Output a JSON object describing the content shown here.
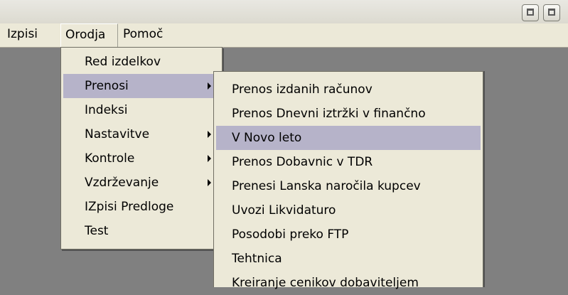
{
  "menubar": {
    "items": [
      "Izpisi",
      "Orodja",
      "Pomoč"
    ]
  },
  "orodja_menu": {
    "items": [
      {
        "label": "Red izdelkov",
        "has_submenu": false
      },
      {
        "label": "Prenosi",
        "has_submenu": true,
        "highlighted": true
      },
      {
        "label": "Indeksi",
        "has_submenu": false
      },
      {
        "label": "Nastavitve",
        "has_submenu": true
      },
      {
        "label": "Kontrole",
        "has_submenu": true
      },
      {
        "label": "Vzdrževanje",
        "has_submenu": true
      },
      {
        "label": "IZpisi Predloge",
        "has_submenu": false
      },
      {
        "label": "Test",
        "has_submenu": false
      }
    ]
  },
  "prenosi_submenu": {
    "items": [
      {
        "label": "Prenos izdanih računov"
      },
      {
        "label": "Prenos Dnevni iztržki v finančno"
      },
      {
        "label": "V Novo leto",
        "highlighted": true
      },
      {
        "label": "Prenos Dobavnic v TDR"
      },
      {
        "label": "Prenesi Lanska naročila kupcev"
      },
      {
        "label": "Uvozi Likvidaturo"
      },
      {
        "label": "Posodobi preko FTP"
      },
      {
        "label": "Tehtnica"
      },
      {
        "label": "Kreiranje cenikov dobaviteljem"
      }
    ]
  },
  "colors": {
    "menu_bg": "#ece9d8",
    "highlight": "#b6b3c9",
    "workspace": "#808080"
  }
}
